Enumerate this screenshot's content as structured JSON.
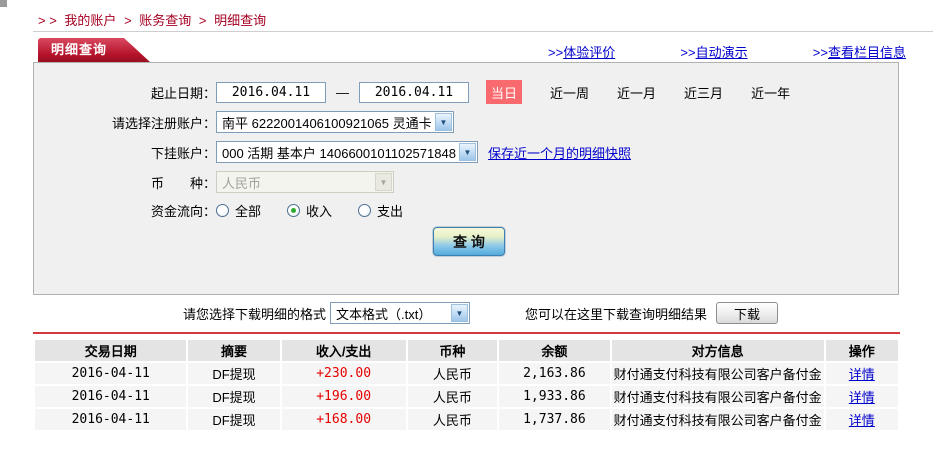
{
  "breadcrumb": {
    "prefix": "> >",
    "separator": ">",
    "items": [
      "我的账户",
      "账务查询",
      "明细查询"
    ]
  },
  "header": {
    "tab_title": "明细查询",
    "links": [
      {
        "prefix": ">>",
        "label": "体验评价"
      },
      {
        "prefix": ">>",
        "label": "自动演示"
      },
      {
        "prefix": ">>",
        "label": "查看栏目信息"
      }
    ]
  },
  "form": {
    "date_range": {
      "label": "起止日期：",
      "start_value": "2016.04.11",
      "separator": "—",
      "end_value": "2016.04.11",
      "quick_active": "当日",
      "quick_options": [
        "近一周",
        "近一月",
        "近三月",
        "近一年"
      ]
    },
    "register_account": {
      "label": "请选择注册账户：",
      "selected": "南平 6222001406100921065 灵通卡"
    },
    "sub_account": {
      "label": "下挂账户：",
      "selected": "000 活期 基本户 1406600101102571848",
      "snapshot_link": "保存近一个月的明细快照"
    },
    "currency": {
      "label": "币　　种：",
      "selected": "人民币",
      "disabled": true
    },
    "fund_flow": {
      "label": "资金流向：",
      "options": [
        {
          "label": "全部",
          "checked": false
        },
        {
          "label": "收入",
          "checked": true
        },
        {
          "label": "支出",
          "checked": false
        }
      ]
    },
    "query_button": "查 询"
  },
  "download": {
    "format_label": "请您选择下载明细的格式",
    "format_selected": "文本格式（.txt）",
    "hint": "您可以在这里下载查询明细结果",
    "button": "下载"
  },
  "table": {
    "headers": [
      "交易日期",
      "摘要",
      "收入/支出",
      "币种",
      "余额",
      "对方信息",
      "操作"
    ],
    "rows": [
      {
        "date": "2016-04-11",
        "summary": "DF提现",
        "amount": "+230.00",
        "currency": "人民币",
        "balance": "2,163.86",
        "counterparty": "财付通支付科技有限公司客户备付金",
        "action": "详情"
      },
      {
        "date": "2016-04-11",
        "summary": "DF提现",
        "amount": "+196.00",
        "currency": "人民币",
        "balance": "1,933.86",
        "counterparty": "财付通支付科技有限公司客户备付金",
        "action": "详情"
      },
      {
        "date": "2016-04-11",
        "summary": "DF提现",
        "amount": "+168.00",
        "currency": "人民币",
        "balance": "1,737.86",
        "counterparty": "财付通支付科技有限公司客户备付金",
        "action": "详情"
      }
    ]
  },
  "colors": {
    "accent_red": "#a50021",
    "badge_red": "#f96a6e",
    "link_blue": "#0000cc",
    "amount_red": "#e60000",
    "panel_bg": "#f0f0f0"
  }
}
